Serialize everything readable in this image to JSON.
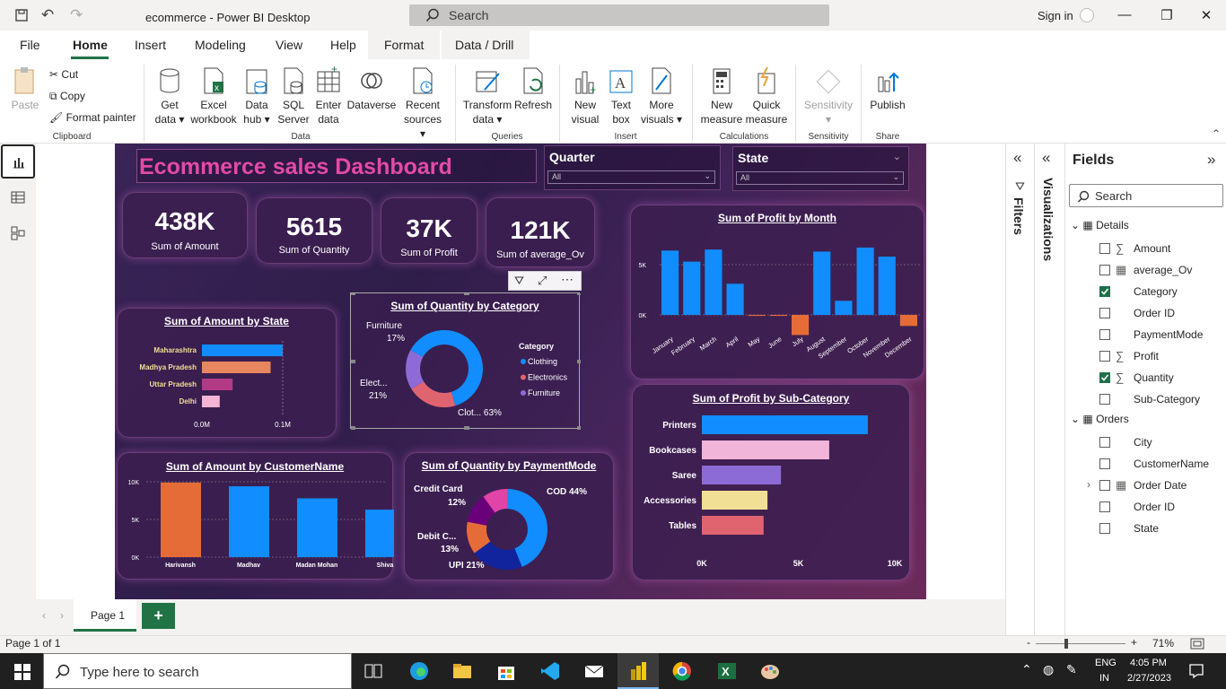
{
  "titlebar": {
    "title": "ecommerce - Power BI Desktop",
    "search_placeholder": "Search",
    "sign_in": "Sign in"
  },
  "menu": [
    "File",
    "Home",
    "Insert",
    "Modeling",
    "View",
    "Help",
    "Format",
    "Data / Drill"
  ],
  "ribbon": {
    "clipboard": {
      "paste": "Paste",
      "cut": "Cut",
      "copy": "Copy",
      "format_painter": "Format painter",
      "group": "Clipboard"
    },
    "data": {
      "get_data_1": "Get",
      "get_data_2": "data",
      "excel_1": "Excel",
      "excel_2": "workbook",
      "hub_1": "Data",
      "hub_2": "hub",
      "sql_1": "SQL",
      "sql_2": "Server",
      "enter_1": "Enter",
      "enter_2": "data",
      "dataverse": "Dataverse",
      "recent_1": "Recent",
      "recent_2": "sources",
      "group": "Data"
    },
    "queries": {
      "transform_1": "Transform",
      "transform_2": "data",
      "refresh": "Refresh",
      "group": "Queries"
    },
    "insert": {
      "newvisual_1": "New",
      "newvisual_2": "visual",
      "textbox_1": "Text",
      "textbox_2": "box",
      "more_1": "More",
      "more_2": "visuals",
      "group": "Insert"
    },
    "calculations": {
      "newmeasure_1": "New",
      "newmeasure_2": "measure",
      "quick_1": "Quick",
      "quick_2": "measure",
      "group": "Calculations"
    },
    "sensitivity": {
      "label": "Sensitivity",
      "group": "Sensitivity"
    },
    "share": {
      "publish": "Publish",
      "group": "Share"
    }
  },
  "dashboard": {
    "title": "Ecommerce sales Dashboard",
    "slicers": [
      {
        "label": "Quarter",
        "value": "All"
      },
      {
        "label": "State",
        "value": "All"
      }
    ],
    "kpis": [
      {
        "value": "438K",
        "label": "Sum of Amount"
      },
      {
        "value": "5615",
        "label": "Sum of Quantity"
      },
      {
        "value": "37K",
        "label": "Sum of Profit"
      },
      {
        "value": "121K",
        "label": "Sum of average_Ov"
      }
    ]
  },
  "chart_data": [
    {
      "type": "bar",
      "orientation": "horizontal",
      "title": "Sum of Amount by State",
      "categories": [
        "Maharashtra",
        "Madhya Pradesh",
        "Uttar Pradesh",
        "Delhi"
      ],
      "values": [
        0.1,
        0.085,
        0.038,
        0.022
      ],
      "tick_labels": [
        "0.0M",
        "0.1M"
      ],
      "xlim": [
        0,
        0.1
      ],
      "colors": [
        "#118dff",
        "#e8865f",
        "#b23a87",
        "#f5b3d6"
      ]
    },
    {
      "type": "pie",
      "donut": true,
      "title": "Sum of Quantity by Category",
      "legend_title": "Category",
      "categories": [
        "Clothing",
        "Electronics",
        "Furniture"
      ],
      "values": [
        63,
        21,
        17
      ],
      "slice_labels": [
        "Clot... 63%",
        "Elect...",
        "21%",
        "Furniture",
        "17%"
      ],
      "colors": [
        "#118dff",
        "#e06470",
        "#8d6bd6"
      ],
      "legend_placement": "right"
    },
    {
      "type": "bar",
      "title": "Sum of Profit by Month",
      "categories": [
        "January",
        "February",
        "March",
        "April",
        "May",
        "June",
        "July",
        "August",
        "September",
        "October",
        "November",
        "December"
      ],
      "values": [
        6400,
        5300,
        6500,
        3100,
        -100,
        -100,
        -2000,
        6300,
        1400,
        6700,
        5800,
        -1100
      ],
      "tick_labels": [
        "5K",
        "0K"
      ],
      "ylim": [
        -2500,
        7500
      ],
      "colors": {
        "positive": "#118dff",
        "negative": "#e66c37"
      }
    },
    {
      "type": "bar",
      "title": "Sum of Amount by CustomerName",
      "categories": [
        "Harivansh",
        "Madhav",
        "Madan Mohan",
        "Shiva"
      ],
      "values": [
        9900,
        9400,
        7800,
        6300
      ],
      "tick_labels": [
        "10K",
        "5K",
        "0K"
      ],
      "ylim": [
        0,
        10000
      ],
      "colors": [
        "#e66c37",
        "#118dff",
        "#118dff",
        "#118dff"
      ]
    },
    {
      "type": "pie",
      "donut": true,
      "title": "Sum of Quantity by PaymentMode",
      "categories": [
        "COD",
        "UPI",
        "Debit Card",
        "Credit Card",
        "EMI"
      ],
      "values": [
        44,
        21,
        13,
        12,
        10
      ],
      "slice_labels": [
        "COD 44%",
        "UPI 21%",
        "Debit C...",
        "13%",
        "Credit Card",
        "12%"
      ],
      "colors": [
        "#118dff",
        "#12239e",
        "#e66c37",
        "#6b007b",
        "#e044a7"
      ]
    },
    {
      "type": "bar",
      "orientation": "horizontal",
      "title": "Sum of Profit by Sub-Category",
      "categories": [
        "Printers",
        "Bookcases",
        "Saree",
        "Accessories",
        "Tables"
      ],
      "values": [
        8600,
        6600,
        4100,
        3400,
        3200
      ],
      "tick_labels": [
        "0K",
        "5K",
        "10K"
      ],
      "xlim": [
        0,
        10000
      ],
      "colors": [
        "#118dff",
        "#f2b5da",
        "#8d6bd6",
        "#f2df96",
        "#e06470"
      ]
    }
  ],
  "panes": {
    "filters": "Filters",
    "visualizations": "Visualizations",
    "fields_title": "Fields",
    "fields_search": "Search",
    "tables": [
      {
        "name": "Details",
        "fields": [
          {
            "name": "Amount",
            "sigma": true,
            "checked": false
          },
          {
            "name": "average_Ov",
            "sigma": false,
            "checked": false
          },
          {
            "name": "Category",
            "sigma": false,
            "checked": true
          },
          {
            "name": "Order ID",
            "sigma": false,
            "checked": false
          },
          {
            "name": "PaymentMode",
            "sigma": false,
            "checked": false
          },
          {
            "name": "Profit",
            "sigma": true,
            "checked": false
          },
          {
            "name": "Quantity",
            "sigma": true,
            "checked": true
          },
          {
            "name": "Sub-Category",
            "sigma": false,
            "checked": false
          }
        ]
      },
      {
        "name": "Orders",
        "fields": [
          {
            "name": "City",
            "sigma": false,
            "checked": false
          },
          {
            "name": "CustomerName",
            "sigma": false,
            "checked": false
          },
          {
            "name": "Order Date",
            "sigma": false,
            "checked": false
          },
          {
            "name": "Order ID",
            "sigma": false,
            "checked": false
          },
          {
            "name": "State",
            "sigma": false,
            "checked": false
          }
        ]
      }
    ]
  },
  "pages": {
    "tab": "Page 1",
    "add": "+"
  },
  "status": {
    "page": "Page 1 of 1",
    "zoom": "71%",
    "zoom_minus": "-",
    "zoom_plus": "+"
  },
  "taskbar": {
    "search": "Type here to search",
    "lang1": "ENG",
    "lang2": "IN",
    "time": "4:05 PM",
    "date": "2/27/2023"
  }
}
